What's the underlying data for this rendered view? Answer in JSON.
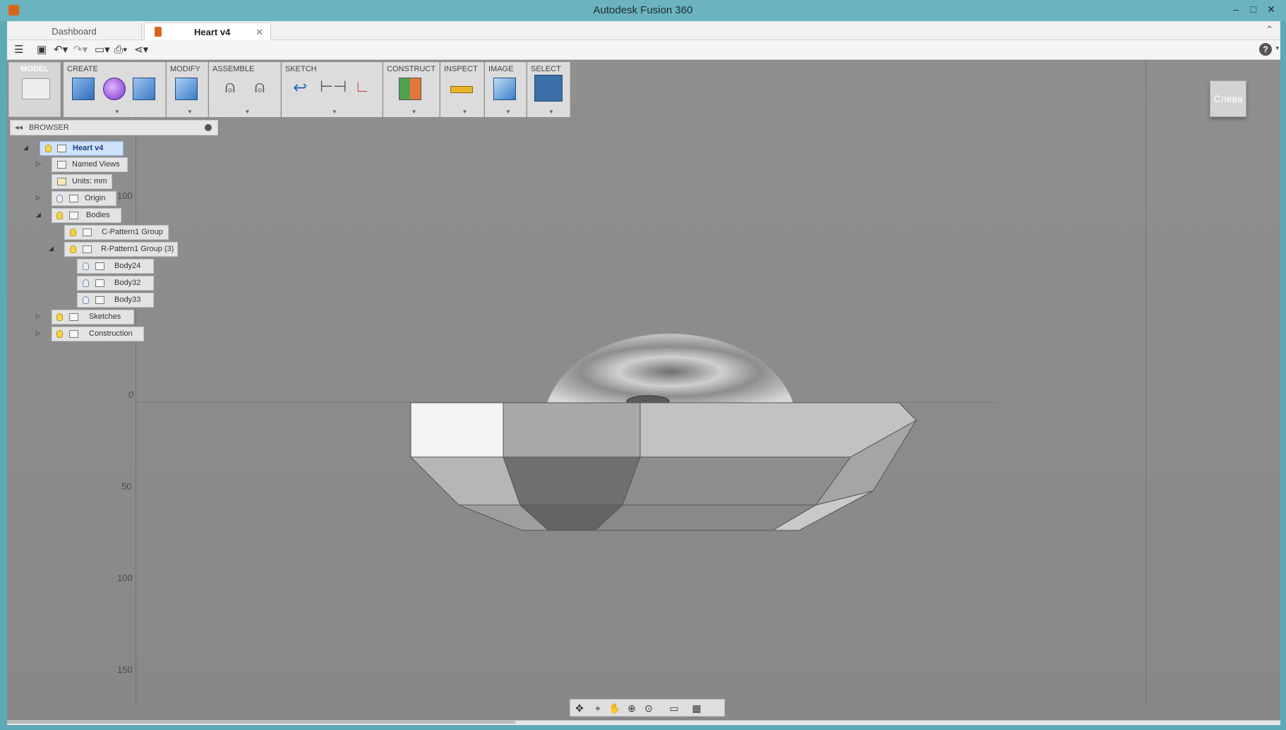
{
  "window": {
    "title": "Autodesk Fusion 360"
  },
  "tabs": {
    "dashboard": "Dashboard",
    "active": "Heart v4"
  },
  "workspace": {
    "label": "MODEL"
  },
  "toolbar": {
    "groups": [
      "CREATE",
      "MODIFY",
      "ASSEMBLE",
      "SKETCH",
      "CONSTRUCT",
      "INSPECT",
      "IMAGE",
      "SELECT"
    ]
  },
  "browser": {
    "label": "BROWSER",
    "nodes": [
      {
        "label": "Heart v4"
      },
      {
        "label": "Named Views"
      },
      {
        "label": "Units: mm"
      },
      {
        "label": "Origin"
      },
      {
        "label": "Bodies"
      },
      {
        "label": "C-Pattern1 Group"
      },
      {
        "label": "R-Pattern1 Group (3)"
      },
      {
        "label": "Body24"
      },
      {
        "label": "Body32"
      },
      {
        "label": "Body33"
      },
      {
        "label": "Sketches"
      },
      {
        "label": "Construction"
      }
    ]
  },
  "viewport": {
    "ruler_labels": [
      "100",
      "0",
      "50",
      "100",
      "150"
    ]
  },
  "viewcube": {
    "face": "Слева"
  },
  "colors": {
    "selection": "#cfe2fb",
    "accent": "#d9651c",
    "frame": "#6cb3c0"
  }
}
